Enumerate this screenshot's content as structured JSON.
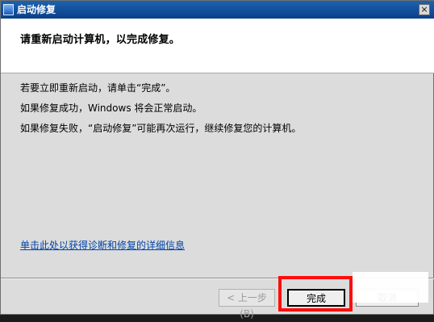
{
  "window": {
    "title": "启动修复",
    "close_glyph": "×"
  },
  "header": {
    "title": "请重新启动计算机，以完成修复。"
  },
  "body": {
    "lines": [
      "若要立即重新启动，请单击“完成”。",
      "如果修复成功，Windows 将会正常启动。",
      "如果修复失败，“启动修复”可能再次运行，继续修复您的计算机。"
    ],
    "detail_link": "单击此处以获得诊断和修复的详细信息"
  },
  "buttons": {
    "back": "< 上一步 (B)",
    "finish": "完成",
    "cancel": "取消"
  },
  "colors": {
    "titlebar": "#0a3f88",
    "highlight": "#ff0d0d",
    "link": "#0044aa"
  }
}
